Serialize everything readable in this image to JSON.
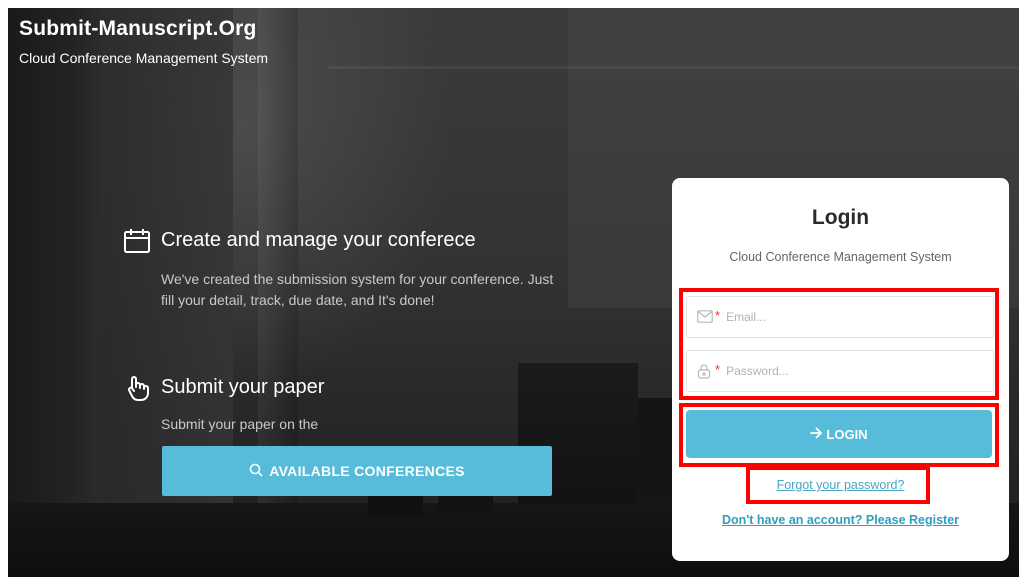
{
  "brand": {
    "title": "Submit-Manuscript.Org",
    "subtitle": "Cloud Conference Management System"
  },
  "features": [
    {
      "icon": "calendar-icon",
      "title": "Create and manage your conferece",
      "description": "We've created the submission system for your conference. Just fill your detail, track, due date, and It's done!"
    },
    {
      "icon": "hand-pointer-icon",
      "title": "Submit your paper",
      "description": "Submit your paper on the"
    }
  ],
  "available_button": {
    "icon": "search-icon",
    "label": "AVAILABLE CONFERENCES"
  },
  "login_card": {
    "title": "Login",
    "subtitle": "Cloud Conference Management System",
    "email": {
      "icon": "envelope-icon",
      "required_mark": "*",
      "placeholder": "Email...",
      "value": ""
    },
    "password": {
      "icon": "lock-icon",
      "required_mark": "*",
      "placeholder": "Password...",
      "value": ""
    },
    "login_button": {
      "icon": "arrow-right-icon",
      "label": "LOGIN"
    },
    "forgot_link": "Forgot your password?",
    "register_link": "Don't have an account? Please Register"
  },
  "colors": {
    "accent": "#56bcd9",
    "highlight": "#ff0000",
    "link": "#4aa6c4",
    "required": "#e0392b"
  }
}
